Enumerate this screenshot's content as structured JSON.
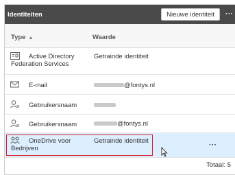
{
  "header": {
    "title": "Identiteiten",
    "new_button": "Nieuwe identiteit",
    "more": "···"
  },
  "columns": {
    "type": "Type",
    "value": "Waarde"
  },
  "rows": [
    {
      "icon": "federation-icon",
      "type": "Active Directory Federation Services",
      "value": "Getrainde identiteit"
    },
    {
      "icon": "mail-icon",
      "type": "E-mail",
      "value": "@fontys.nl"
    },
    {
      "icon": "user-icon",
      "type": "Gebruikersnaam",
      "value": ""
    },
    {
      "icon": "user-icon",
      "type": "Gebruikersnaam",
      "value": "@fontys.nl"
    },
    {
      "icon": "onedrive-icon",
      "type": "OneDrive voor Bedrijven",
      "value": "Getrainde identiteit",
      "more": "···"
    }
  ],
  "footer": {
    "total": "Totaal: 5"
  },
  "colors": {
    "header_bg": "#4a4a4a",
    "selected_row": "#ddeeff",
    "highlight": "#d21e28"
  }
}
